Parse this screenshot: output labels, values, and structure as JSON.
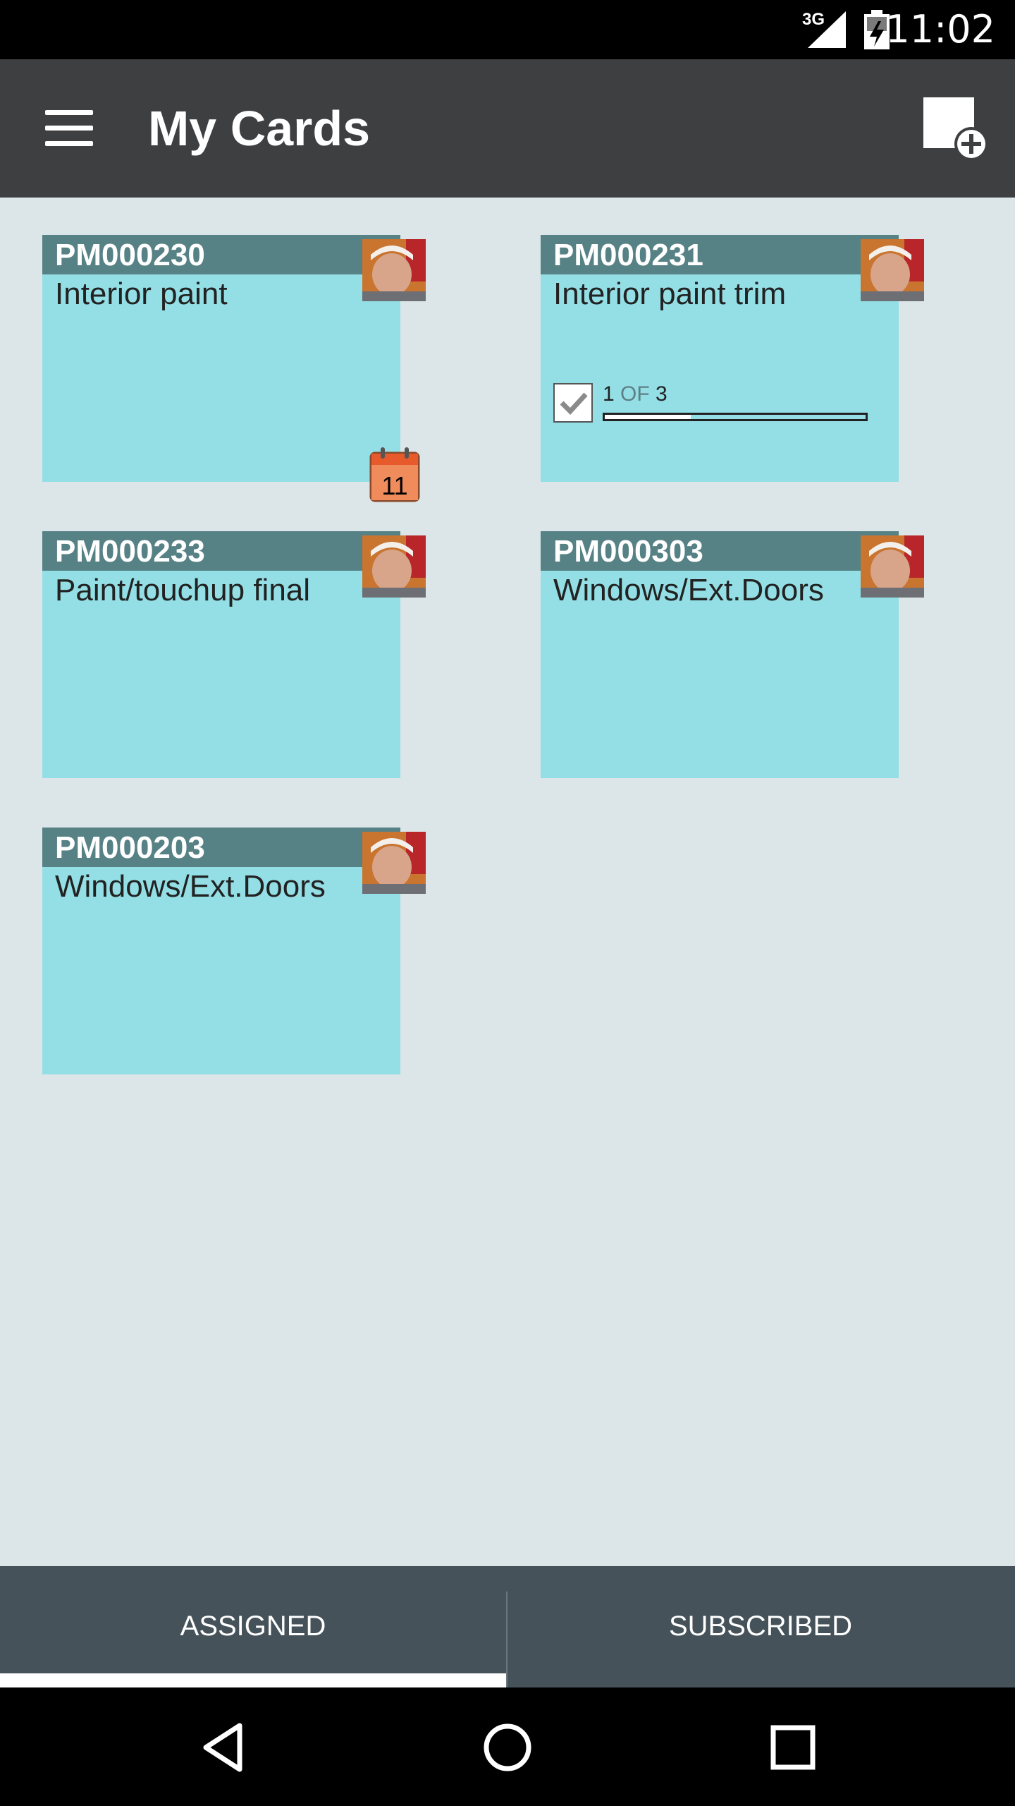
{
  "status_bar": {
    "time": "11:02",
    "network": "3G"
  },
  "app_bar": {
    "title": "My Cards"
  },
  "cards": [
    {
      "id": "PM000230",
      "title": "Interior paint",
      "due_day": "11"
    },
    {
      "id": "PM000231",
      "title": "Interior paint trim",
      "checklist": {
        "done": "1",
        "of": "OF",
        "total": "3",
        "progress": 0.33
      }
    },
    {
      "id": "PM000233",
      "title": "Paint/touchup final"
    },
    {
      "id": "PM000303",
      "title": "Windows/Ext.Doors"
    },
    {
      "id": "PM000203",
      "title": "Windows/Ext.Doors"
    }
  ],
  "tabs": [
    {
      "label": "ASSIGNED",
      "selected": true
    },
    {
      "label": "SUBSCRIBED",
      "selected": false
    }
  ],
  "colors": {
    "card_body": "#93dfe5",
    "card_header": "#568185",
    "app_bar": "#3e3f41",
    "tab_bar": "#455259",
    "background": "#dce6e8"
  }
}
